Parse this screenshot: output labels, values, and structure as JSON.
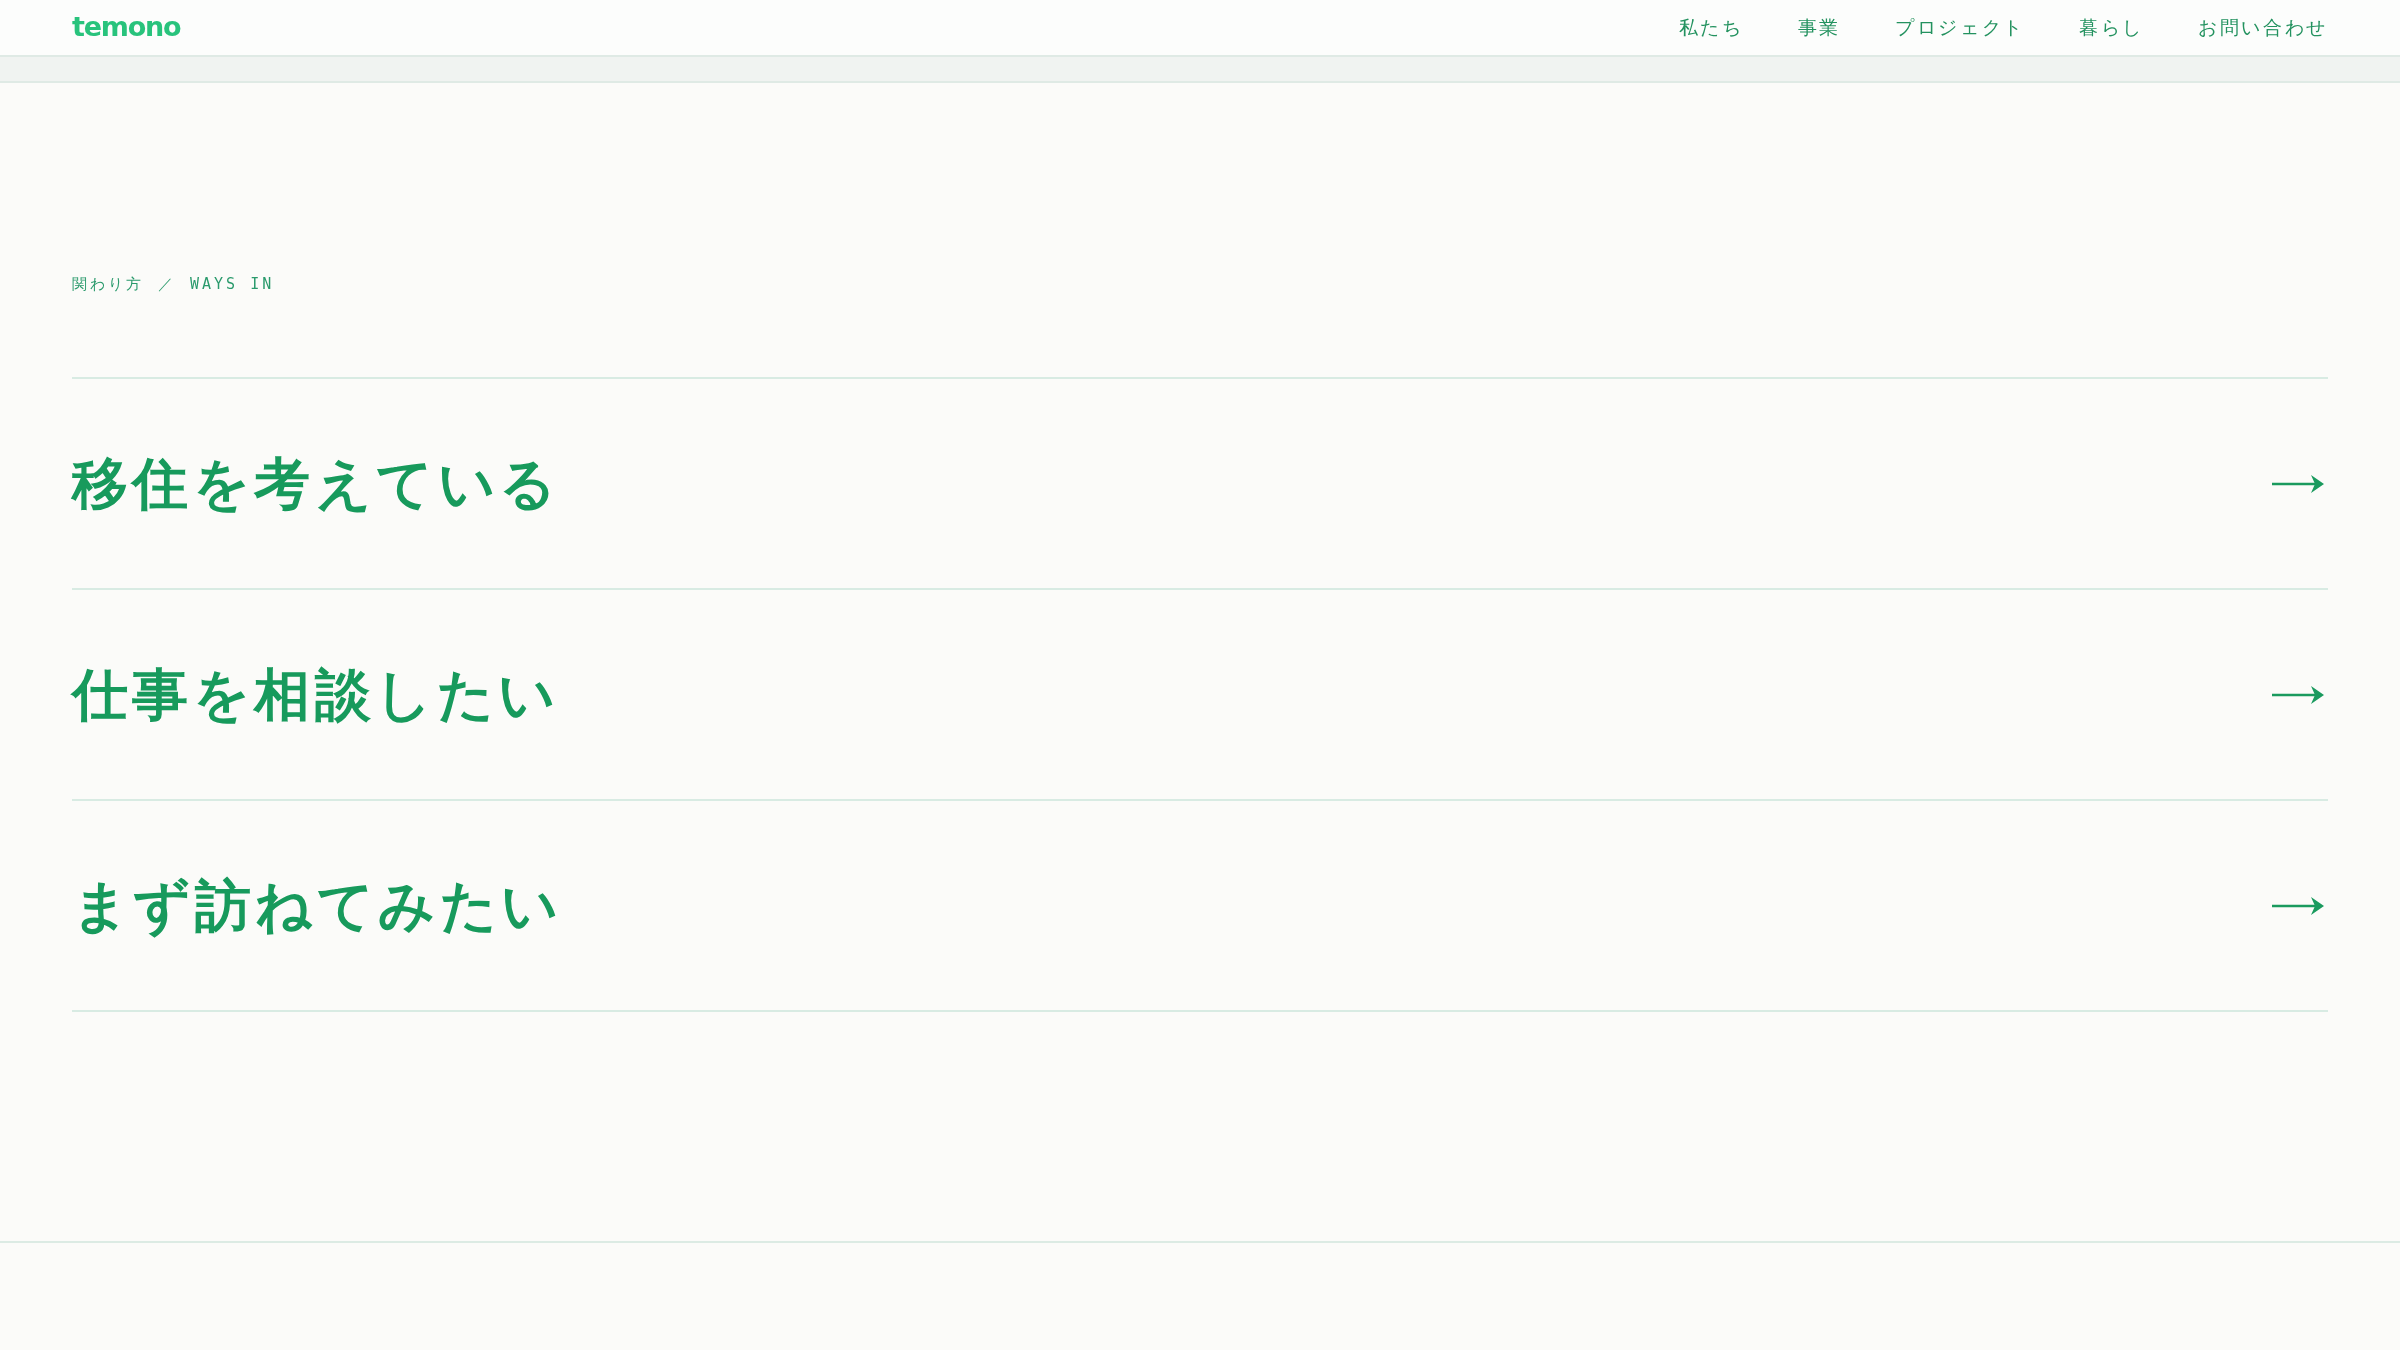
{
  "header": {
    "logo": "temono",
    "nav": [
      "私たち",
      "事業",
      "プロジェクト",
      "暮らし",
      "お問い合わせ"
    ]
  },
  "breadcrumb": {
    "label_ja": "関わり方",
    "separator": "／",
    "label_en": "WAYS IN"
  },
  "options": [
    {
      "title": "移住を考えている"
    },
    {
      "title": "仕事を相談したい"
    },
    {
      "title": "まず訪ねてみたい"
    }
  ]
}
